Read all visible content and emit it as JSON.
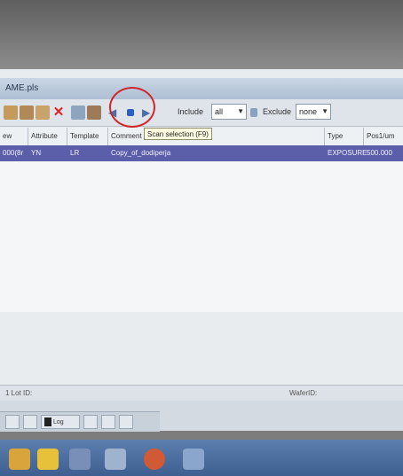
{
  "window": {
    "title": "AME.pls"
  },
  "toolbar": {
    "include_label": "Include",
    "include_value": "all",
    "exclude_label": "Exclude",
    "exclude_value": "none"
  },
  "tooltip": "Scan selection (F9)",
  "table": {
    "columns": [
      "ew",
      "Attribute",
      "Template",
      "Comment",
      "Type",
      "Pos1/um"
    ],
    "rows": [
      {
        "col0": "000(8r",
        "attribute": "YN",
        "template": "LR",
        "comment": "Copy_of_dodiperja",
        "type": "EXPOSURE",
        "pos": "500.000"
      }
    ]
  },
  "status": {
    "left": "1  Lot ID:",
    "right": "WaferID:"
  },
  "bottom_tabs": {
    "log_label": "Log"
  },
  "colors": {
    "selection": "#5b5ea8",
    "highlight_circle": "#d0262c"
  }
}
